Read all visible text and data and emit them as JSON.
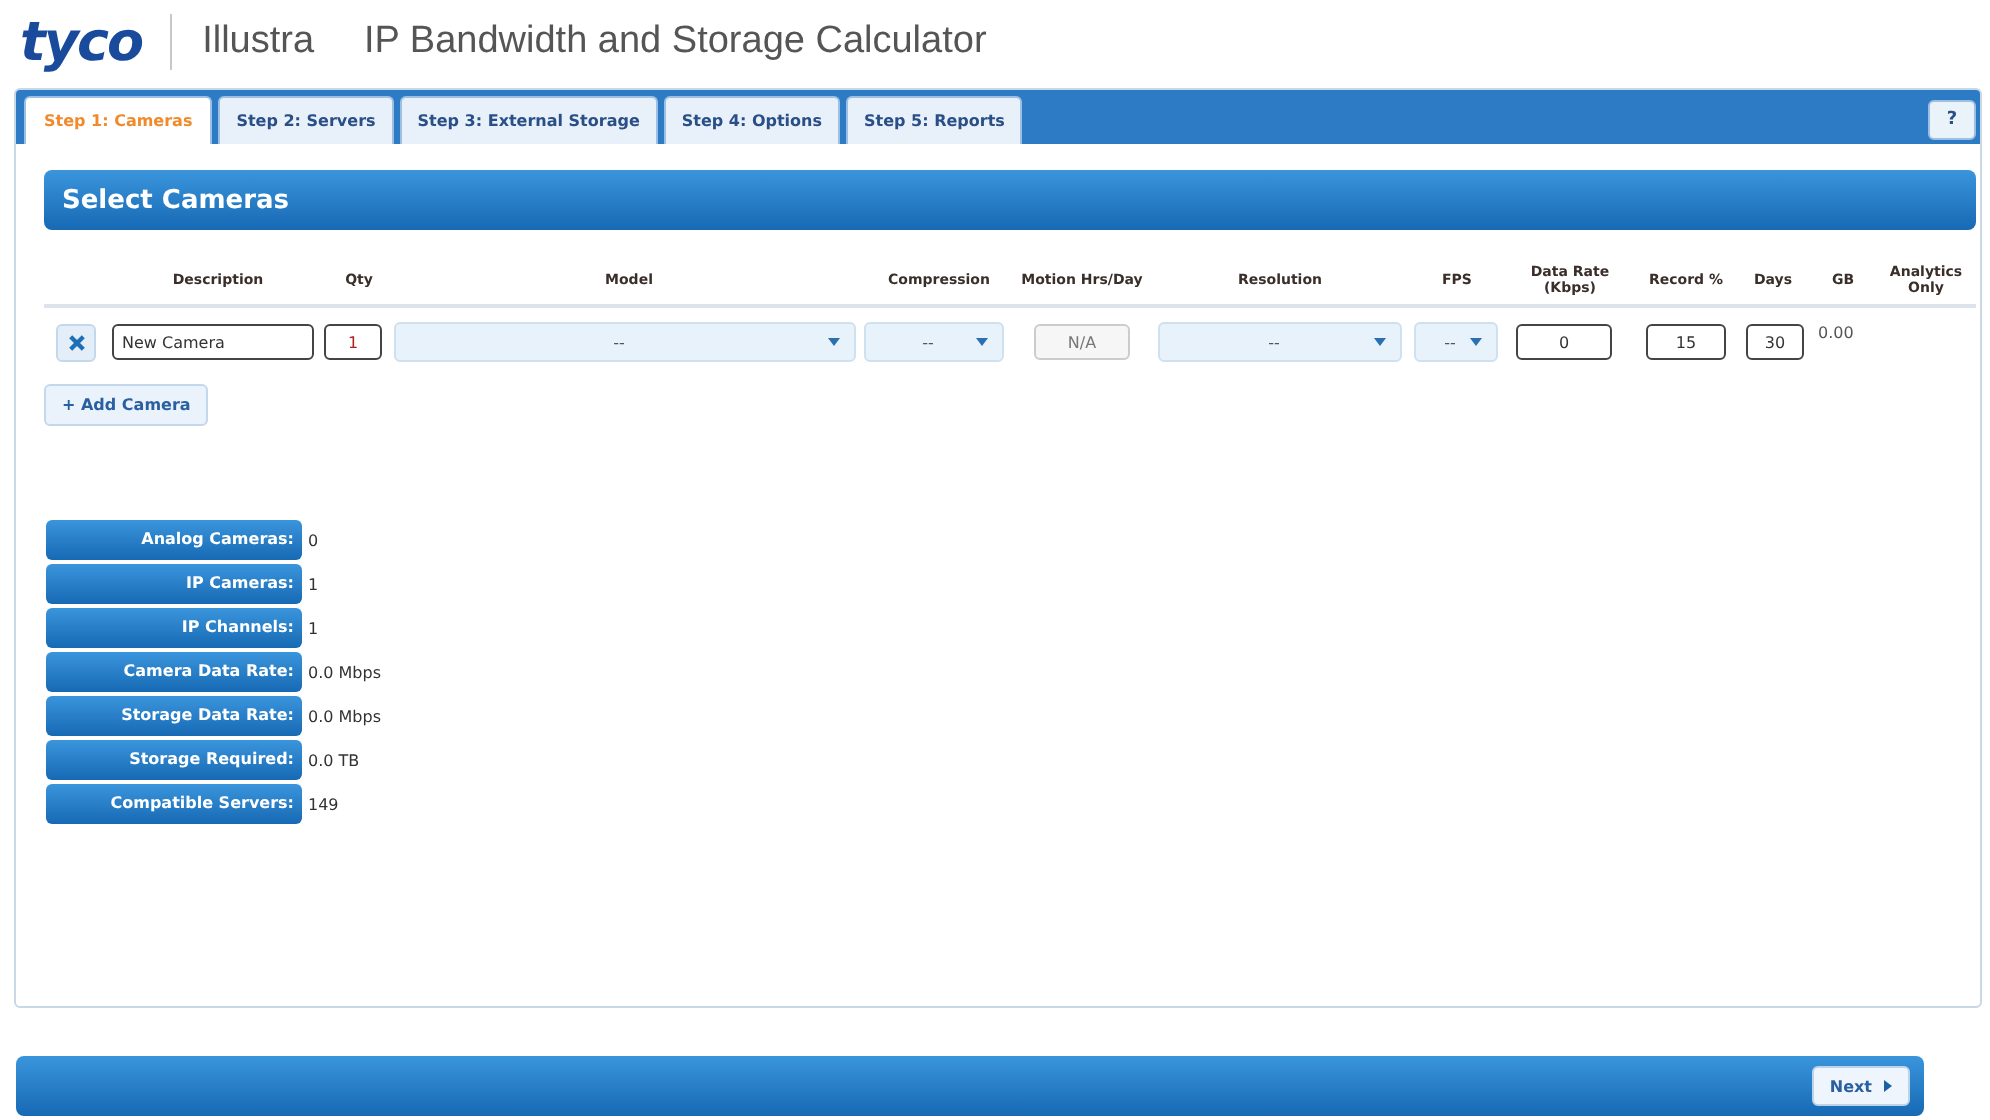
{
  "header": {
    "brand": "tyco",
    "product": "Illustra",
    "title": "IP Bandwidth and Storage Calculator"
  },
  "tabs": [
    {
      "label": "Step 1: Cameras",
      "selected": true
    },
    {
      "label": "Step 2: Servers",
      "selected": false
    },
    {
      "label": "Step 3: External Storage",
      "selected": false
    },
    {
      "label": "Step 4: Options",
      "selected": false
    },
    {
      "label": "Step 5: Reports",
      "selected": false
    }
  ],
  "help_button": "?",
  "section_title": "Select Cameras",
  "columns": [
    "Description",
    "Qty",
    "Model",
    "Compression",
    "Motion Hrs/Day",
    "Resolution",
    "FPS",
    "Data Rate (Kbps)",
    "Record %",
    "Days",
    "GB",
    "Analytics Only"
  ],
  "rows": [
    {
      "description": "New Camera",
      "qty": "1",
      "model": "--",
      "compression": "--",
      "motion": "N/A",
      "motion_disabled": true,
      "resolution": "--",
      "fps": "--",
      "data_rate": "0",
      "record": "15",
      "days": "30",
      "gb": "0.00"
    }
  ],
  "add_button": "+ Add Camera",
  "summary": [
    {
      "label": "Analog Cameras:",
      "value": "0"
    },
    {
      "label": "IP Cameras:",
      "value": "1"
    },
    {
      "label": "IP Channels:",
      "value": "1"
    },
    {
      "label": "Camera Data Rate:",
      "value": "0.0 Mbps"
    },
    {
      "label": "Storage Data Rate:",
      "value": "0.0 Mbps"
    },
    {
      "label": "Storage Required:",
      "value": "0.0 TB"
    },
    {
      "label": "Compatible Servers:",
      "value": "149"
    }
  ],
  "next_button": "Next"
}
